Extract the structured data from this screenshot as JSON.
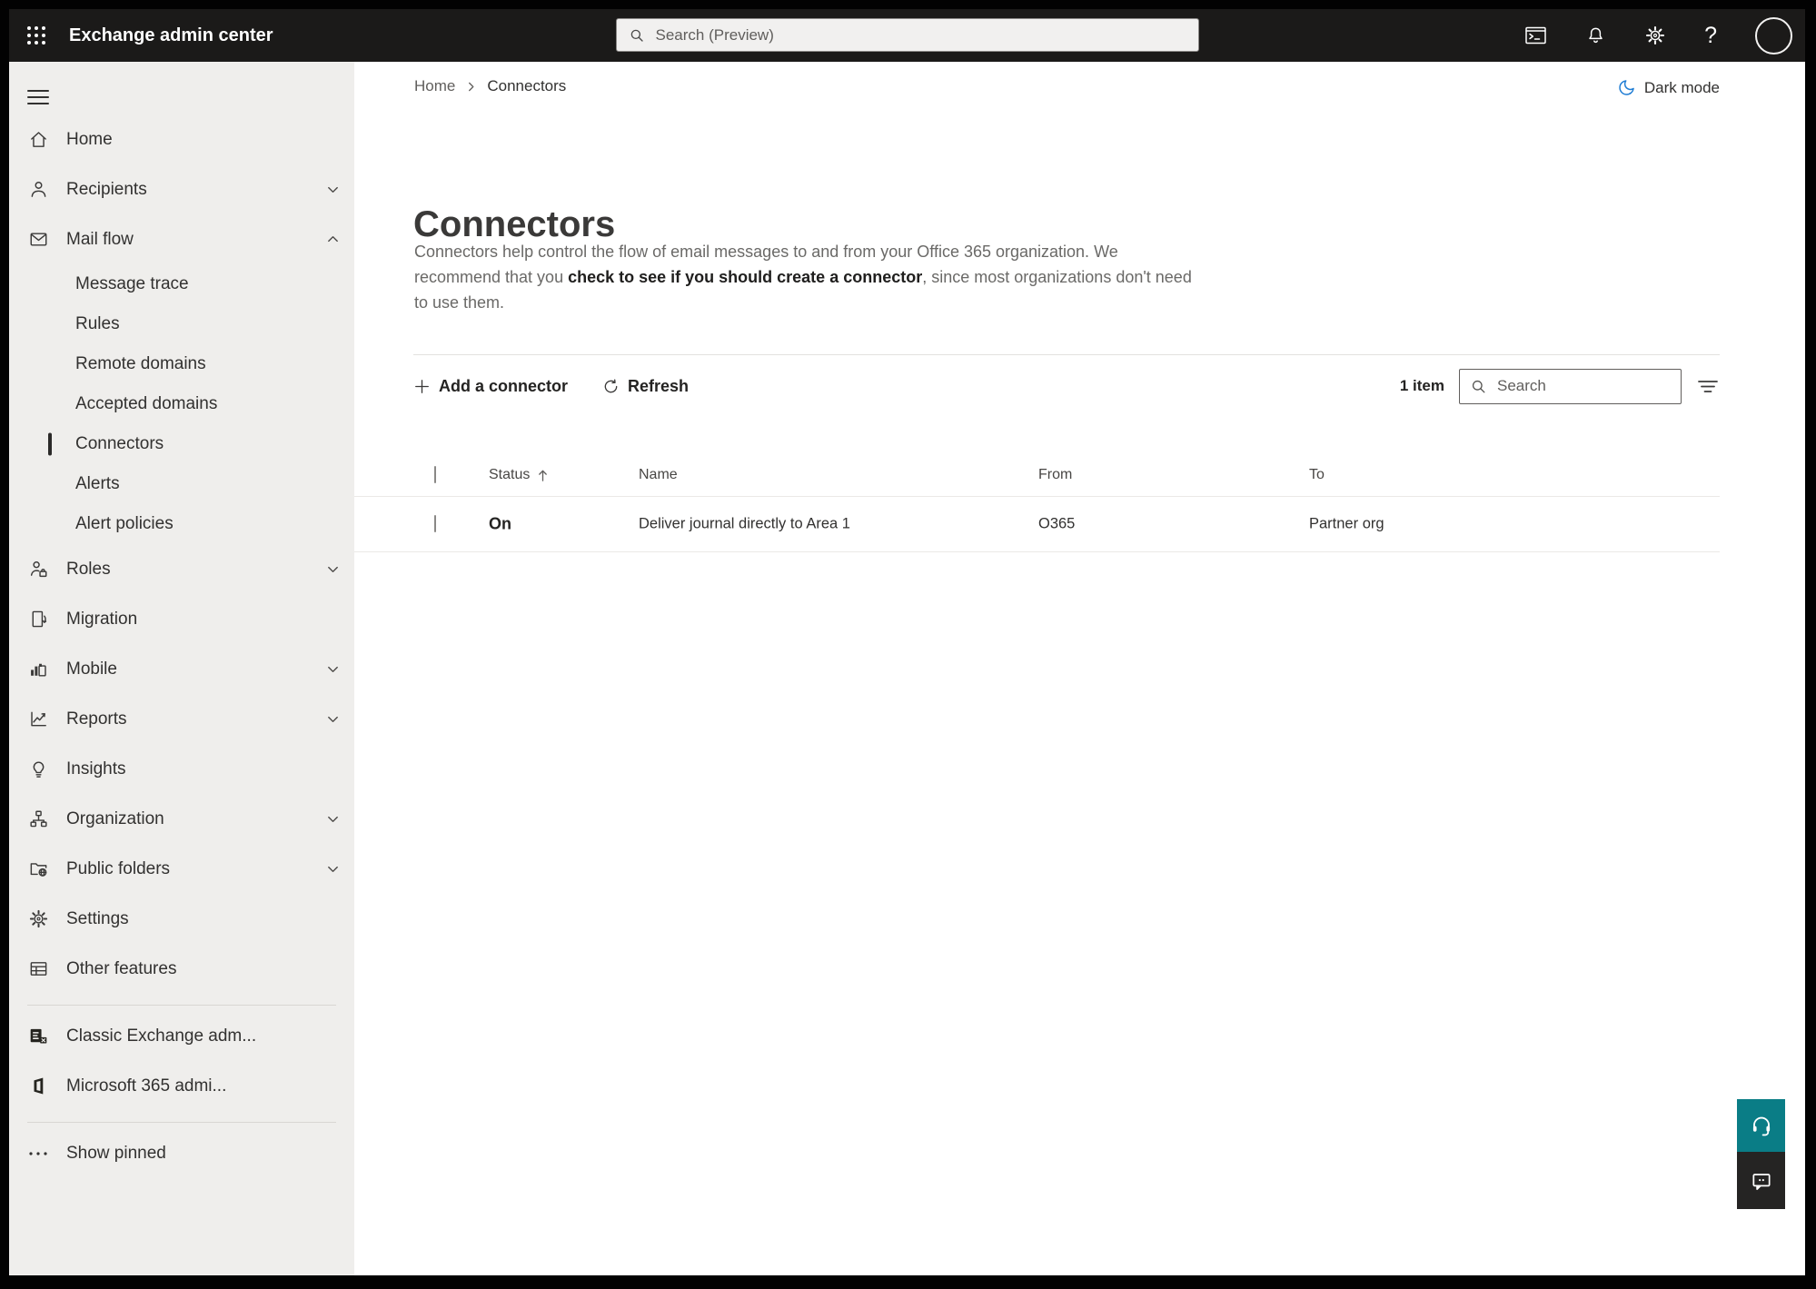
{
  "topbar": {
    "title": "Exchange admin center",
    "search_placeholder": "Search (Preview)"
  },
  "breadcrumb": {
    "home": "Home",
    "current": "Connectors"
  },
  "darkmode_label": "Dark mode",
  "page": {
    "title": "Connectors",
    "description_part1": "Connectors help control the flow of email messages to and from your Office 365 organization. We recommend that you ",
    "description_emphasis": "check to see if you should create a connector",
    "description_part2": ", since most organizations don't need to use them."
  },
  "toolbar": {
    "add_label": "Add a connector",
    "refresh_label": "Refresh",
    "item_count": "1 item",
    "search_placeholder": "Search"
  },
  "table": {
    "columns": {
      "status": "Status",
      "name": "Name",
      "from": "From",
      "to": "To"
    },
    "rows": [
      {
        "status": "On",
        "name": "Deliver journal directly to Area 1",
        "from": "O365",
        "to": "Partner org"
      }
    ]
  },
  "sidebar": {
    "items": [
      {
        "label": "Home",
        "icon": "home"
      },
      {
        "label": "Recipients",
        "icon": "person",
        "chevron": "down"
      },
      {
        "label": "Mail flow",
        "icon": "mail",
        "chevron": "up",
        "expanded": true
      },
      {
        "label": "Message trace"
      },
      {
        "label": "Rules"
      },
      {
        "label": "Remote domains"
      },
      {
        "label": "Accepted domains"
      },
      {
        "label": "Connectors",
        "selected": true
      },
      {
        "label": "Alerts"
      },
      {
        "label": "Alert policies"
      },
      {
        "label": "Roles",
        "icon": "person-briefcase",
        "chevron": "down"
      },
      {
        "label": "Migration",
        "icon": "document-arrow"
      },
      {
        "label": "Mobile",
        "icon": "mobile-chart",
        "chevron": "down"
      },
      {
        "label": "Reports",
        "icon": "line-chart",
        "chevron": "down"
      },
      {
        "label": "Insights",
        "icon": "lightbulb"
      },
      {
        "label": "Organization",
        "icon": "org-chart",
        "chevron": "down"
      },
      {
        "label": "Public folders",
        "icon": "folder-globe",
        "chevron": "down"
      },
      {
        "label": "Settings",
        "icon": "gear"
      },
      {
        "label": "Other features",
        "icon": "table-grid"
      },
      {
        "label": "Classic Exchange adm...",
        "icon": "exchange-logo"
      },
      {
        "label": "Microsoft 365 admi...",
        "icon": "office-logo"
      },
      {
        "label": "Show pinned",
        "icon": "ellipsis"
      }
    ]
  },
  "icons": {
    "app-launcher": "3x3 dot waffle",
    "terminal-icon": "admin shell window",
    "bell-icon": "notifications",
    "gear-icon": "settings",
    "help-icon": "?",
    "moon-icon": "crescent",
    "search-icon": "magnifier",
    "filter-icon": "three lines",
    "plus-icon": "+",
    "refresh-icon": "circular arrow",
    "sort-up-icon": "arrow up",
    "headset-icon": "support",
    "chat-icon": "feedback bubble"
  },
  "colors": {
    "topbar_bg": "#1b1a19",
    "sidebar_bg": "#efeeec",
    "selected_indicator": "#2b2a29",
    "teal_fab": "#0a7d86",
    "chat_fab": "#252423",
    "moon_blue": "#1f7dd4",
    "text_dark": "#323130",
    "text_gray": "#605e5c"
  }
}
